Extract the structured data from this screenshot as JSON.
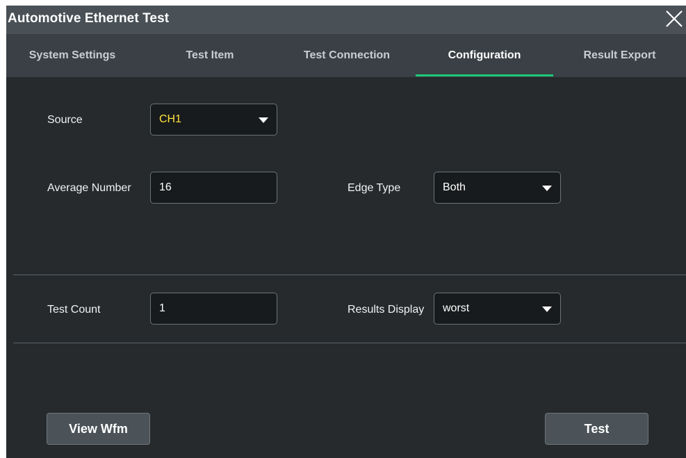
{
  "window": {
    "title": "Automotive Ethernet Test"
  },
  "tabs": [
    {
      "label": "System Settings",
      "active": false
    },
    {
      "label": "Test Item",
      "active": false
    },
    {
      "label": "Test Connection",
      "active": false
    },
    {
      "label": "Configuration",
      "active": true
    },
    {
      "label": "Result Export",
      "active": false
    }
  ],
  "config": {
    "source": {
      "label": "Source",
      "value": "CH1"
    },
    "average_number": {
      "label": "Average Number",
      "value": "16"
    },
    "edge_type": {
      "label": "Edge Type",
      "value": "Both"
    },
    "test_count": {
      "label": "Test Count",
      "value": "1"
    },
    "results_display": {
      "label": "Results Display",
      "value": "worst"
    }
  },
  "buttons": {
    "view_wfm": "View Wfm",
    "test": "Test"
  },
  "colors": {
    "accent": "#1ec878",
    "source_value": "#ffe23d",
    "background": "#262a2d",
    "titlebar": "#495156",
    "tabbar": "#3a4045"
  },
  "icons": {
    "close": "close-icon",
    "dropdown": "caret-down-icon"
  }
}
